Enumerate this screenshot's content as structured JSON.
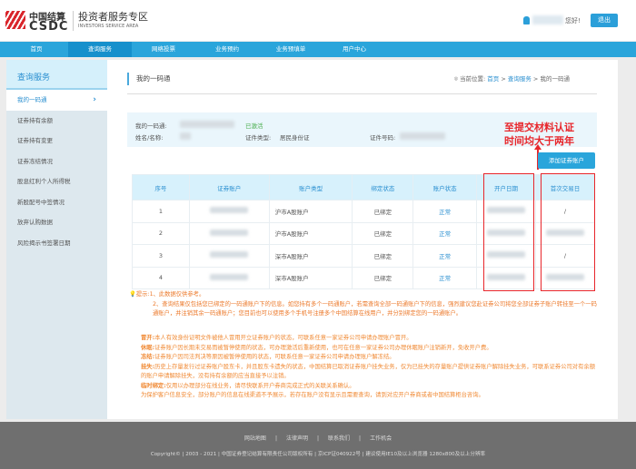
{
  "header": {
    "logo_cn": "中国结算",
    "logo_en": "CSDC",
    "zone_cn": "投资者服务专区",
    "zone_en": "INVESTORS SERVICE AREA",
    "greeting": "您好!",
    "logout": "退出"
  },
  "nav": [
    "首页",
    "查询服务",
    "网络投票",
    "业务预约",
    "业务预填单",
    "用户中心"
  ],
  "sidebar": {
    "title": "查询服务",
    "items": [
      "我的一码通",
      "证券持有余额",
      "证券持有变更",
      "证券冻结情况",
      "股息红利个人所得税",
      "新股配号中签情况",
      "放弃认购数据",
      "风险揭示书签署日期"
    ]
  },
  "page": {
    "title": "我的一码通",
    "crumb_label": "当前位置:",
    "crumb": [
      "首页",
      "查询服务",
      "我的一码通"
    ]
  },
  "info": {
    "code_label": "我的一码通:",
    "status": "已激活",
    "name_label": "姓名/名称:",
    "id_type_label": "证件类型:",
    "id_type": "居民身份证",
    "id_no_label": "证件号码:"
  },
  "annotation": [
    "至提交材料认证",
    "时间均大于两年"
  ],
  "add_button": "添加证券账户",
  "table": {
    "headers": [
      "序号",
      "证券账户",
      "账户类型",
      "绑定状态",
      "账户状态",
      "开户日期",
      "首次交易日"
    ],
    "rows": [
      {
        "no": "1",
        "type": "沪市A股账户",
        "bind": "已绑定",
        "status": "正常",
        "first": "/"
      },
      {
        "no": "2",
        "type": "沪市A股账户",
        "bind": "已绑定",
        "status": "正常",
        "first": ""
      },
      {
        "no": "3",
        "type": "深市A股账户",
        "bind": "已绑定",
        "status": "正常",
        "first": "/"
      },
      {
        "no": "4",
        "type": "深市A股账户",
        "bind": "已绑定",
        "status": "正常",
        "first": ""
      }
    ]
  },
  "tips": {
    "label": "提示:",
    "line1": "1、此数据仅供参考。",
    "line2": "2、查询结果仅包括您已绑定的一码通账户下的信息。如您持有多个一码通账户，若需查询全部一码通账户下的信息，强烈建议您赴证券公司将您全部证券子账户转挂至一个一码通账户，并注销其余一码通账户；您目前也可以使用多个手机号注册多个中国结算在线用户，并分别绑定您的一码通账户。"
  },
  "legend": [
    {
      "k": "冒开:",
      "v": "本人有效身份证明文件被他人冒用开立证券账户的状态，可联系任意一家证券公司申请办理账户冒开。"
    },
    {
      "k": "休眠:",
      "v": "证券账户因长期未交易而被暂停使用的状态，可办理激活后重新使用，也可在任意一家证券公司办理休眠账户注销新开，免收开户费。"
    },
    {
      "k": "冻结:",
      "v": "证券账户因司法判决等原因被暂停使用的状态，可联系任意一家证券公司申请办理账户解冻结。"
    },
    {
      "k": "挂失:",
      "v": "历史上存量发行过证券账户股东卡，并且股东卡遗失的状态，中国结算已取消证券账户挂失业务，仅为已挂失的存量账户提供证券账户解除挂失业务，可联系证券公司对有余额的账户申请解除挂失，没有持有余额的应当直接予以注销。"
    },
    {
      "k": "临时绑定:",
      "v": "仅用以办理部分在线业务，请尽快联系开户券商完成正式的关联关系确认。"
    },
    {
      "k": "",
      "v": "为保护客户信息安全，部分账户的信息在线渠道不予展示，若存在账户没有显示且需要查询，请到对应开户券商或者中国结算柜台咨询。"
    }
  ],
  "footer": {
    "links": [
      "网站地图",
      "法律声明",
      "联系我们",
      "工作机会"
    ],
    "copyright": "Copyright© | 2003 - 2021 | 中国证券登记结算有限责任公司版权所有 | 京ICP证040922号 | 建议使用IE10及以上浏览器 1280x800及以上分辨率"
  }
}
